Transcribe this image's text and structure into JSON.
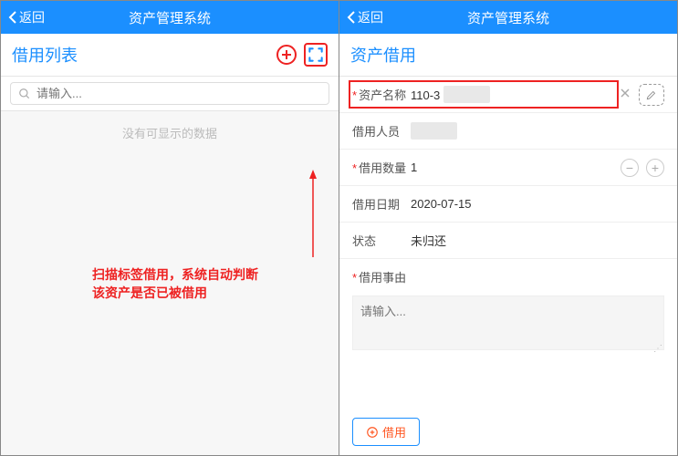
{
  "header": {
    "back": "返回",
    "title": "资产管理系统"
  },
  "left": {
    "title": "借用列表",
    "search_placeholder": "请输入...",
    "empty": "没有可显示的数据",
    "annotation_l1": "扫描标签借用，系统自动判断",
    "annotation_l2": "该资产是否已被借用"
  },
  "right": {
    "title": "资产借用",
    "fields": {
      "asset_name": {
        "label": "资产名称",
        "value": "110-3"
      },
      "borrower": {
        "label": "借用人员",
        "value": "　　　"
      },
      "qty": {
        "label": "借用数量",
        "value": "1"
      },
      "date": {
        "label": "借用日期",
        "value": "2020-07-15"
      },
      "status": {
        "label": "状态",
        "value": "未归还"
      },
      "reason": {
        "label": "借用事由",
        "placeholder": "请输入..."
      }
    },
    "submit": "借用"
  }
}
